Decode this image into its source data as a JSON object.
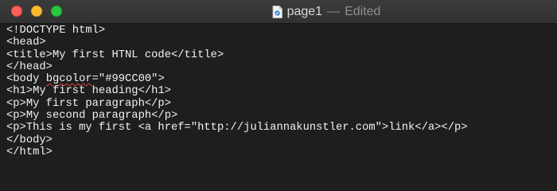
{
  "window": {
    "filename": "page1",
    "separator": "—",
    "status": "Edited",
    "traffic_lights": {
      "close": "#fe5f57",
      "minimize": "#febc2e",
      "zoom": "#28c840"
    }
  },
  "editor": {
    "background": "#1e1e1e",
    "text_color": "#f2f2f2",
    "lines": [
      "<!DOCTYPE html>",
      "<head>",
      "<title>My first HTNL code</title>",
      "</head>",
      "<h1>My first heading</h1>",
      "<p>My first paragraph</p>",
      "<p>My second paragraph</p>",
      "<p>This is my first <a href=\"http://juliannakunstler.com\">link</a></p>",
      "</body>",
      "</html>"
    ],
    "body_line": {
      "prefix": "<body ",
      "misspelled_word": "bgcolor",
      "suffix": "=\"#99CC00\">"
    }
  }
}
